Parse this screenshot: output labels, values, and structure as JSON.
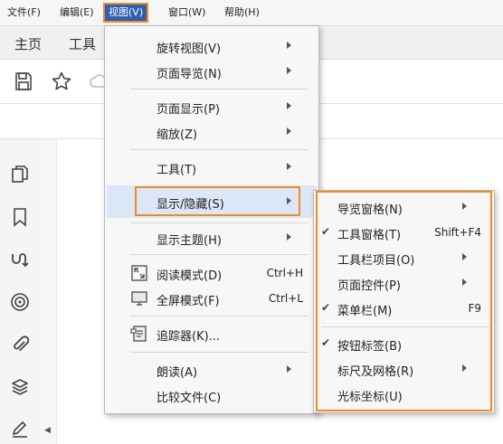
{
  "menubar": {
    "file": "文件(F)",
    "edit": "编辑(E)",
    "view": "视图(V)",
    "window": "窗口(W)",
    "help": "帮助(H)"
  },
  "tabs": {
    "home": "主页",
    "tools": "工具"
  },
  "view_menu": {
    "rotate": "旋转视图(V)",
    "page_nav": "页面导览(N)",
    "page_display": "页面显示(P)",
    "zoom": "缩放(Z)",
    "tools": "工具(T)",
    "show_hide": "显示/隐藏(S)",
    "theme": "显示主题(H)",
    "reading_mode": "阅读模式(D)",
    "reading_mode_shortcut": "Ctrl+H",
    "full_screen": "全屏模式(F)",
    "full_screen_shortcut": "Ctrl+L",
    "tracker": "追踪器(K)...",
    "read_aloud": "朗读(A)",
    "compare": "比较文件(C)"
  },
  "show_hide_menu": {
    "nav_panes": "导览窗格(N)",
    "tools_pane": "工具窗格(T)",
    "tools_pane_shortcut": "Shift+F4",
    "toolbar_items": "工具栏项目(O)",
    "page_controls": "页面控件(P)",
    "menu_bar": "菜单栏(M)",
    "menu_bar_shortcut": "F9",
    "button_labels": "按钮标签(B)",
    "rulers_grids": "标尺及网格(R)",
    "cursor_coords": "光标坐标(U)",
    "check_mark": "✔"
  },
  "colors": {
    "accent_highlight": "#f08a24",
    "menu_active": "#2f5faf",
    "hover": "#dbe6f6"
  }
}
